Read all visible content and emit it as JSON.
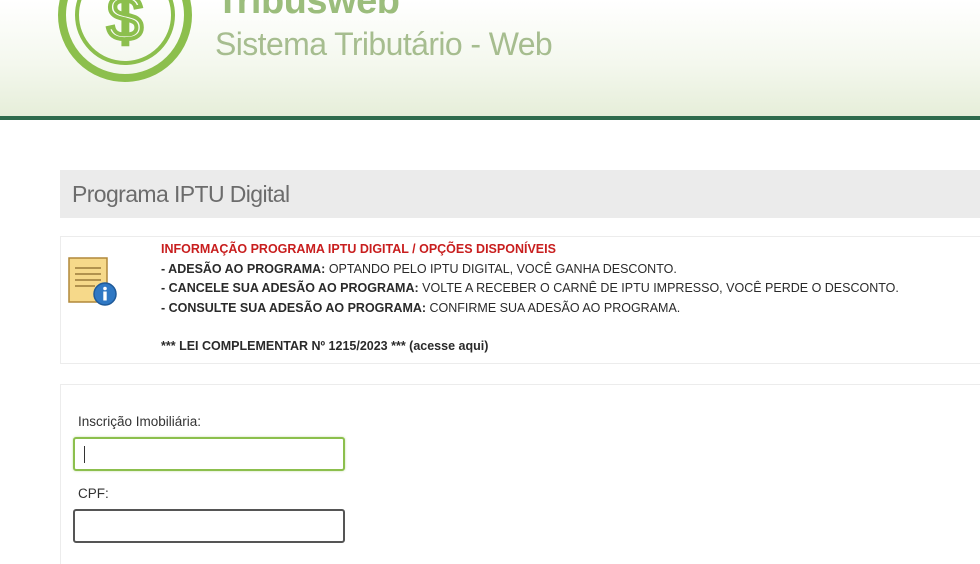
{
  "header": {
    "brand_title": "Tribusweb",
    "brand_subtitle": "Sistema Tributário - Web",
    "logo_icon": "dollar-coin-icon",
    "accent_color": "#2e6b4c",
    "logo_color": "#8cbf4d"
  },
  "page": {
    "title": "Programa IPTU Digital"
  },
  "info": {
    "icon": "document-info-icon",
    "heading": "INFORMAÇÃO PROGRAMA IPTU DIGITAL / OPÇÕES DISPONÍVEIS",
    "items": [
      {
        "label": "- ADESÃO AO PROGRAMA:",
        "text": " OPTANDO PELO IPTU DIGITAL, VOCÊ GANHA DESCONTO."
      },
      {
        "label": "- CANCELE SUA ADESÃO AO PROGRAMA:",
        "text": " VOLTE A RECEBER O CARNÊ DE IPTU IMPRESSO, VOCÊ PERDE O DESCONTO."
      },
      {
        "label": "- CONSULTE SUA ADESÃO AO PROGRAMA:",
        "text": " CONFIRME SUA ADESÃO AO PROGRAMA."
      }
    ],
    "law_text": "*** LEI COMPLEMENTAR Nº 1215/2023 *** (acesse aqui)",
    "heading_color": "#c81e1e"
  },
  "form": {
    "inscricao": {
      "label": "Inscrição Imobiliária:",
      "value": "",
      "placeholder": ""
    },
    "cpf": {
      "label": "CPF:",
      "value": "",
      "placeholder": ""
    }
  }
}
